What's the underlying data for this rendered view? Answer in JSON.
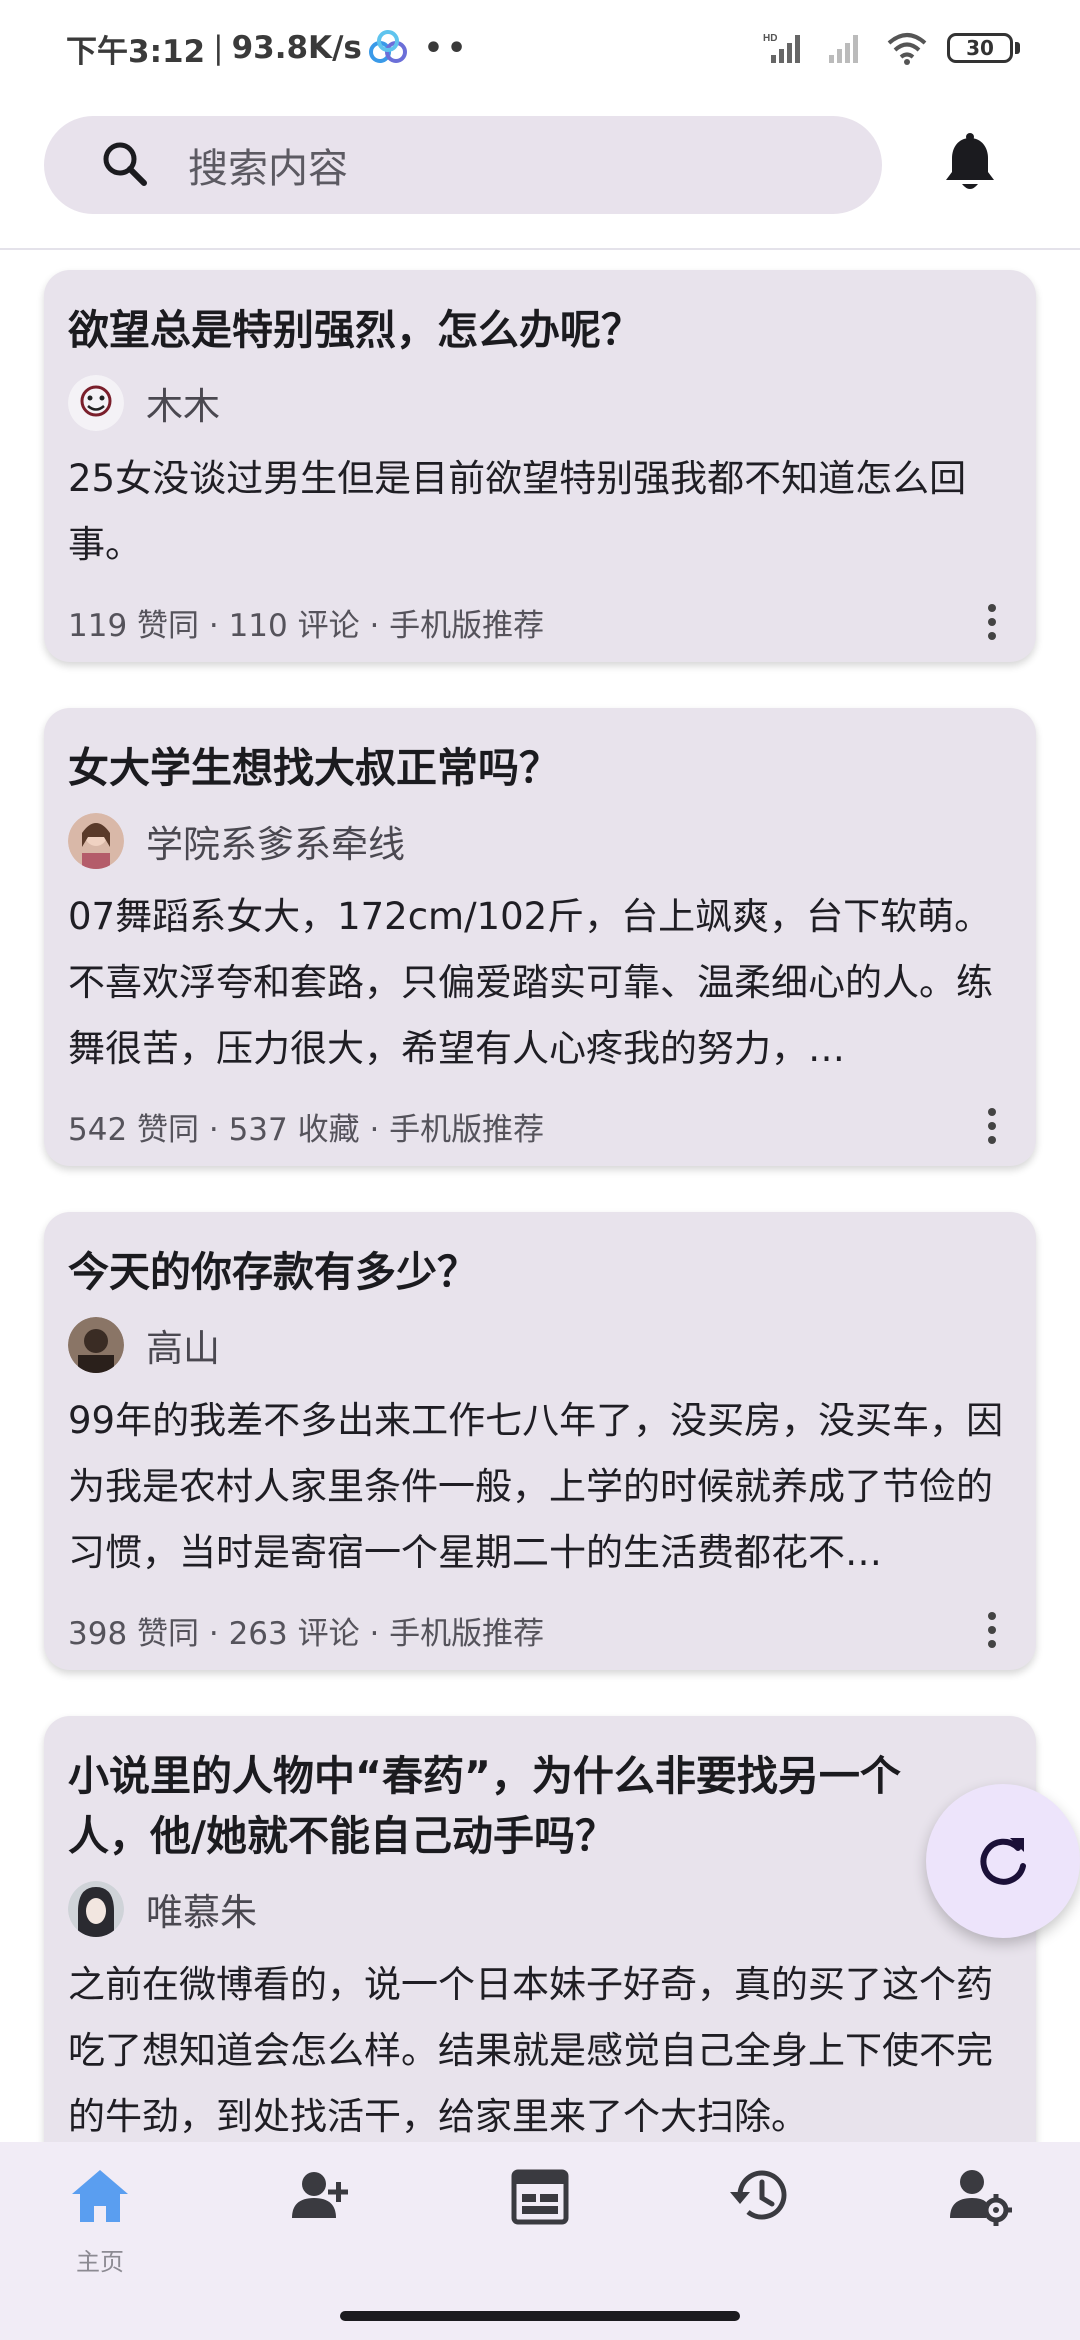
{
  "status_bar": {
    "time": "下午3:12",
    "network_speed": "93.8K/s",
    "separator": "|",
    "extra": "••",
    "network_label": "HD",
    "battery": "30"
  },
  "search": {
    "placeholder": "搜索内容"
  },
  "cards": [
    {
      "title": "欲望总是特别强烈，怎么办呢？",
      "author": "木木",
      "excerpt": "25女没谈过男生但是目前欲望特别强我都不知道怎么回事。",
      "meta": "119 赞同 · 110 评论 · 手机版推荐"
    },
    {
      "title": "女大学生想找大叔正常吗？",
      "author": "学院系爹系牵线",
      "excerpt": "07舞蹈系女大，172cm/102斤，台上飒爽，台下软萌。不喜欢浮夸和套路，只偏爱踏实可靠、温柔细心的人。练舞很苦，压力很大，希望有人心疼我的努力，…",
      "meta": "542 赞同 · 537 收藏 · 手机版推荐"
    },
    {
      "title": "今天的你存款有多少？",
      "author": "高山",
      "excerpt": "99年的我差不多出来工作七八年了，没买房，没买车，因为我是农村人家里条件一般，上学的时候就养成了节俭的习惯，当时是寄宿一个星期二十的生活费都花不…",
      "meta": "398 赞同 · 263 评论 · 手机版推荐"
    },
    {
      "title": "小说里的人物中“春药”，为什么非要找另一个人，他/她就不能自己动手吗？",
      "author": "唯慕朱",
      "excerpt": "之前在微博看的，说一个日本妹子好奇，真的买了这个药吃了想知道会怎么样。结果就是感觉自己全身上下使不完的牛劲，到处找活干，给家里来了个大扫除。",
      "meta": ""
    }
  ],
  "bottom_nav": {
    "home_label": "主页",
    "items": [
      "home-icon",
      "add-user-icon",
      "calendar-icon",
      "history-icon",
      "user-settings-icon"
    ]
  },
  "colors": {
    "card_bg": "#e8e3ec",
    "search_bg": "#e8e2ec",
    "nav_bg": "#f1ecf6",
    "nav_active": "#5a9ef0",
    "fab_bg": "#ede4fb",
    "icon_dark": "#1b1b1f"
  }
}
